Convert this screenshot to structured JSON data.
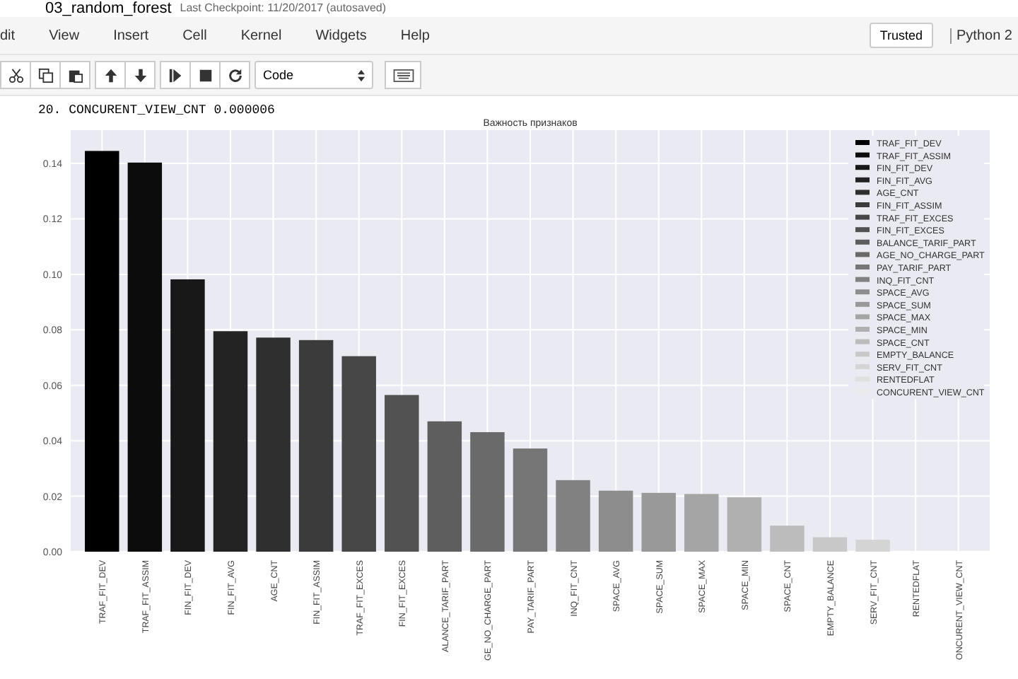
{
  "notebook": {
    "name": "03_random_forest",
    "checkpoint": "Last Checkpoint: 11/20/2017 (autosaved)"
  },
  "menu": [
    "dit",
    "View",
    "Insert",
    "Cell",
    "Kernel",
    "Widgets",
    "Help"
  ],
  "trusted": "Trusted",
  "kernel": "Python 2",
  "cell_type": "Code",
  "output_line": "20. CONCURENT_VIEW_CNT 0.000006",
  "chart": {
    "chart_data": {
      "type": "bar",
      "title": "Важность признаков",
      "categories": [
        "TRAF_FIT_DEV",
        "TRAF_FIT_ASSIM",
        "FIN_FIT_DEV",
        "FIN_FIT_AVG",
        "AGE_CNT",
        "FIN_FIT_ASSIM",
        "TRAF_FIT_EXCES",
        "FIN_FIT_EXCES",
        "ALANCE_TARIF_PART",
        "GE_NO_CHARGE_PART",
        "PAY_TARIF_PART",
        "INQ_FIT_CNT",
        "SPACE_AVG",
        "SPACE_SUM",
        "SPACE_MAX",
        "SPACE_MIN",
        "SPACE_CNT",
        "EMPTY_BALANCE",
        "SERV_FIT_CNT",
        "RENTEDFLAT",
        "ONCURENT_VIEW_CNT"
      ],
      "values": [
        0.1445,
        0.1403,
        0.0982,
        0.0795,
        0.0772,
        0.0763,
        0.0705,
        0.0565,
        0.047,
        0.0431,
        0.0372,
        0.0258,
        0.022,
        0.0212,
        0.0208,
        0.0196,
        0.0094,
        0.0052,
        0.0043,
        0.0,
        0.0
      ],
      "grid": true,
      "ylim": [
        0,
        0.152
      ],
      "yticks": [
        {
          "value": 0,
          "label": "0.00"
        },
        {
          "value": 0.02,
          "label": "0.02"
        },
        {
          "value": 0.04,
          "label": "0.04"
        },
        {
          "value": 0.06,
          "label": "0.06"
        },
        {
          "value": 0.08,
          "label": "0.08"
        },
        {
          "value": 0.1,
          "label": "0.10"
        },
        {
          "value": 0.12,
          "label": "0.12"
        },
        {
          "value": 0.14,
          "label": "0.14"
        }
      ]
    },
    "legend": [
      "TRAF_FIT_DEV",
      "TRAF_FIT_ASSIM",
      "FIN_FIT_DEV",
      "FIN_FIT_AVG",
      "AGE_CNT",
      "FIN_FIT_ASSIM",
      "TRAF_FIT_EXCES",
      "FIN_FIT_EXCES",
      "BALANCE_TARIF_PART",
      "AGE_NO_CHARGE_PART",
      "PAY_TARIF_PART",
      "INQ_FIT_CNT",
      "SPACE_AVG",
      "SPACE_SUM",
      "SPACE_MAX",
      "SPACE_MIN",
      "SPACE_CNT",
      "EMPTY_BALANCE",
      "SERV_FIT_CNT",
      "RENTEDFLAT",
      "CONCURENT_VIEW_CNT"
    ]
  }
}
